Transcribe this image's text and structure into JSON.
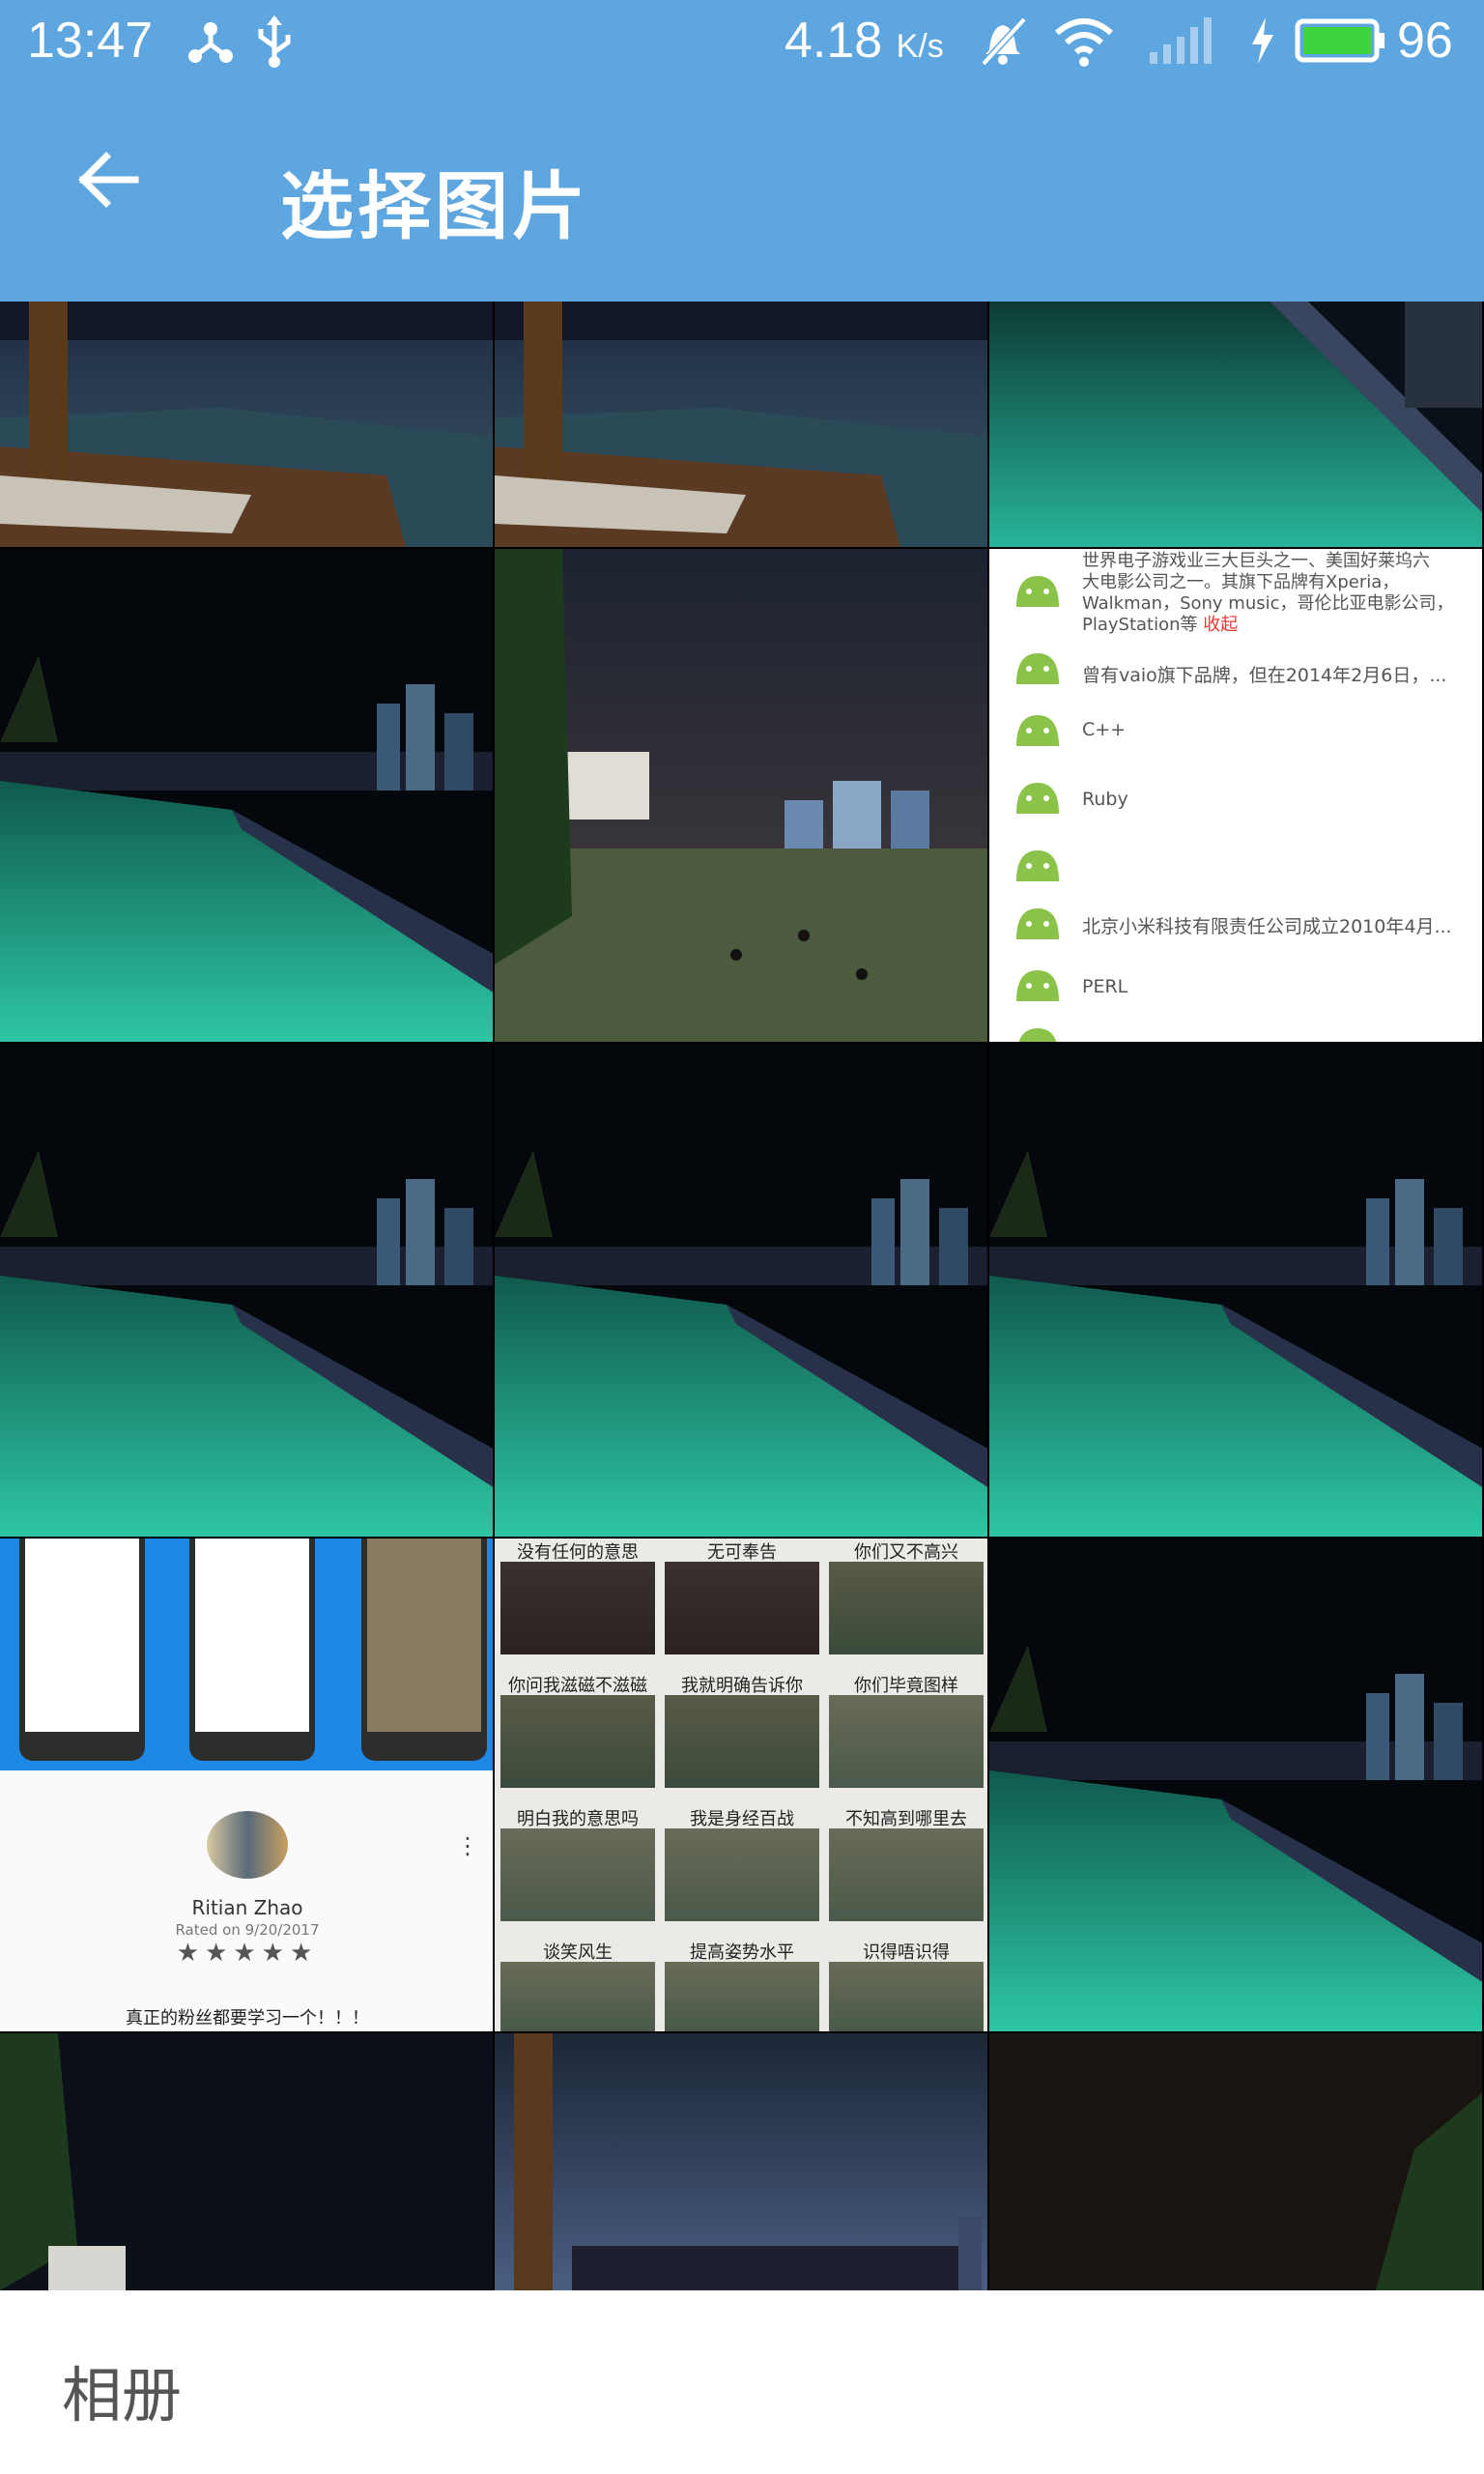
{
  "status_bar": {
    "time": "13:47",
    "network_speed": "4.18",
    "network_speed_unit": "K/s",
    "battery": "96",
    "icons": [
      "share-icon",
      "usb-icon",
      "mute-bell-icon",
      "wifi-icon",
      "signal-icon",
      "charging-icon",
      "battery-icon"
    ]
  },
  "toolbar": {
    "back_icon": "arrow-left-icon",
    "title": "选择图片"
  },
  "grid": {
    "list_screenshot": {
      "text_top": [
        "世界电子游戏业三大巨头之一、美国好莱坞六",
        "大电影公司之一。其旗下品牌有Xperia，",
        "Walkman，Sony music，哥伦比亚电影公司，",
        "PlayStation等"
      ],
      "collapse_link": "收起",
      "rows": [
        "曾有vaio旗下品牌，但在2014年2月6日，...",
        "C++",
        "Ruby",
        "",
        "北京小米科技有限责任公司成立2010年4月...",
        "PERL"
      ]
    },
    "review_screenshot": {
      "reviewer_name": "Ritian Zhao",
      "rated_on": "Rated on 9/20/2017",
      "stars": 5,
      "review_text": "真正的粉丝都要学习一个！！！"
    },
    "meme_screenshot": {
      "captions": [
        "没有任何的意思",
        "无可奉告",
        "你们又不高兴",
        "你问我滋磁不滋磁",
        "我就明确告诉你",
        "你们毕竟图样",
        "明白我的意思吗",
        "我是身经百战",
        "不知高到哪里去",
        "谈笑风生",
        "提高姿势水平",
        "识得唔识得"
      ]
    }
  },
  "bottom_bar": {
    "album_label": "相册"
  },
  "colors": {
    "app_bar": "#5ea6e0",
    "android_green": "#8bc34a",
    "link_red": "#e53935"
  }
}
